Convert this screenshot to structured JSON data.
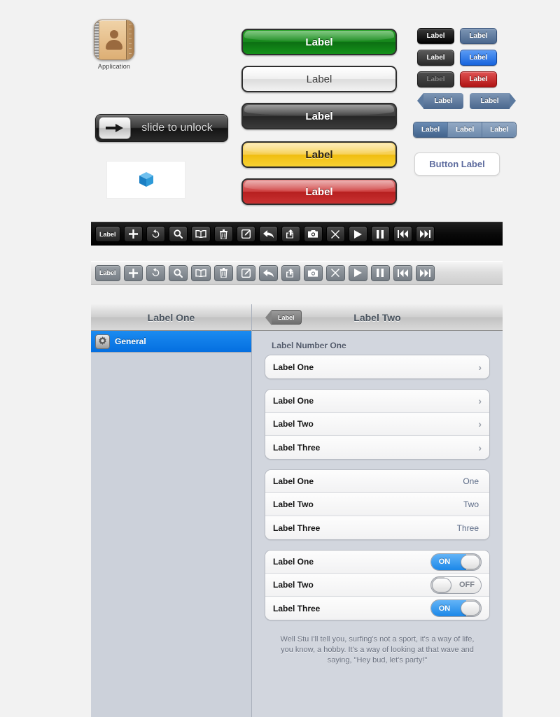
{
  "app_icon": {
    "label": "Application",
    "icon": "contacts-book-icon"
  },
  "slide_to_unlock": {
    "text": "slide to unlock",
    "handle_icon": "arrow-right-icon"
  },
  "cube_panel": {
    "icon": "blue-cube-icon"
  },
  "big_buttons": [
    {
      "label": "Label",
      "variant": "green",
      "color": "#15861b"
    },
    {
      "label": "Label",
      "variant": "white",
      "color": "#efefef"
    },
    {
      "label": "Label",
      "variant": "dark",
      "color": "#3c3c3c"
    },
    {
      "label": "Label",
      "variant": "yellow",
      "color": "#f6cf4e"
    },
    {
      "label": "Label",
      "variant": "red",
      "color": "#cf4040"
    }
  ],
  "small_buttons": [
    {
      "label": "Label",
      "variant": "black",
      "color": "#000000"
    },
    {
      "label": "Label",
      "variant": "steel",
      "color": "#4a678d"
    },
    {
      "label": "Label",
      "variant": "gray",
      "color": "#3a3a3a"
    },
    {
      "label": "Label",
      "variant": "blue",
      "color": "#1764dd"
    },
    {
      "label": "Label",
      "variant": "disabled",
      "color": "#3e3e3e"
    },
    {
      "label": "Label",
      "variant": "red",
      "color": "#b01414"
    }
  ],
  "nav_arrow_buttons": [
    {
      "label": "Label",
      "icon": "back-arrow-shape"
    },
    {
      "label": "Label",
      "icon": "forward-arrow-shape"
    }
  ],
  "segmented_control": {
    "segments": [
      {
        "label": "Label",
        "selected": true
      },
      {
        "label": "Label",
        "selected": false
      },
      {
        "label": "Label",
        "selected": false
      }
    ]
  },
  "white_button": {
    "label": "Button Label",
    "color": "#5d6b9e"
  },
  "toolbars": {
    "dark": {
      "items": [
        {
          "type": "label",
          "label": "Label",
          "icon": "text-label"
        },
        {
          "type": "icon",
          "icon": "plus-icon"
        },
        {
          "type": "icon",
          "icon": "refresh-icon"
        },
        {
          "type": "icon",
          "icon": "search-icon"
        },
        {
          "type": "icon",
          "icon": "book-icon"
        },
        {
          "type": "icon",
          "icon": "trash-icon"
        },
        {
          "type": "icon",
          "icon": "compose-icon"
        },
        {
          "type": "icon",
          "icon": "reply-icon"
        },
        {
          "type": "icon",
          "icon": "share-icon"
        },
        {
          "type": "icon",
          "icon": "camera-icon"
        },
        {
          "type": "icon",
          "icon": "close-icon"
        },
        {
          "type": "icon",
          "icon": "play-icon"
        },
        {
          "type": "icon",
          "icon": "pause-icon"
        },
        {
          "type": "icon",
          "icon": "rewind-icon"
        },
        {
          "type": "icon",
          "icon": "fast-forward-icon"
        }
      ]
    },
    "light": {
      "items": [
        {
          "type": "label",
          "label": "Label",
          "icon": "text-label"
        },
        {
          "type": "icon",
          "icon": "plus-icon"
        },
        {
          "type": "icon",
          "icon": "refresh-icon"
        },
        {
          "type": "icon",
          "icon": "search-icon"
        },
        {
          "type": "icon",
          "icon": "book-icon"
        },
        {
          "type": "icon",
          "icon": "trash-icon"
        },
        {
          "type": "icon",
          "icon": "compose-icon"
        },
        {
          "type": "icon",
          "icon": "reply-icon"
        },
        {
          "type": "icon",
          "icon": "share-icon"
        },
        {
          "type": "icon",
          "icon": "camera-icon"
        },
        {
          "type": "icon",
          "icon": "close-icon"
        },
        {
          "type": "icon",
          "icon": "play-icon"
        },
        {
          "type": "icon",
          "icon": "pause-icon"
        },
        {
          "type": "icon",
          "icon": "rewind-icon"
        },
        {
          "type": "icon",
          "icon": "fast-forward-icon"
        }
      ]
    }
  },
  "splitview": {
    "left": {
      "title": "Label One",
      "rows": [
        {
          "label": "General",
          "icon": "gear-icon",
          "selected": true,
          "selected_color": "#046fe0"
        }
      ]
    },
    "right": {
      "title": "Label Two",
      "back_button": "Label",
      "group_header": "Label Number One",
      "group_single": [
        {
          "title": "Label One",
          "accessory": "chevron"
        }
      ],
      "group_chevrons": [
        {
          "title": "Label One",
          "accessory": "chevron"
        },
        {
          "title": "Label Two",
          "accessory": "chevron"
        },
        {
          "title": "Label Three",
          "accessory": "chevron"
        }
      ],
      "group_values": [
        {
          "title": "Label One",
          "value": "One"
        },
        {
          "title": "Label Two",
          "value": "Two"
        },
        {
          "title": "Label Three",
          "value": "Three"
        }
      ],
      "group_switches": [
        {
          "title": "Label One",
          "state": "ON",
          "on": true
        },
        {
          "title": "Label Two",
          "state": "OFF",
          "on": false
        },
        {
          "title": "Label Three",
          "state": "ON",
          "on": true
        }
      ],
      "switch_on_label": "ON",
      "switch_off_label": "OFF",
      "footer": "Well Stu I'll tell you, surfing's not a sport, it's a way of life, you know, a hobby. It's a way of looking at that wave and saying, \"Hey bud, let's party!\""
    }
  }
}
